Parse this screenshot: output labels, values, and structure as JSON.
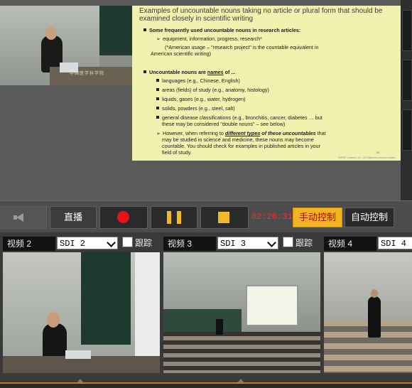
{
  "slide": {
    "title": "Examples of uncountable nouns taking no article or plural form that should be examined closely in scientific writing",
    "heading1": "Some frequently used uncountable nouns in research articles:",
    "line1": "equipment, information, progress, research*",
    "line2a": "(*American usage – \"research project\" is the countable equivalent in",
    "line2b": "American scientific writing)",
    "heading2_pre": "Uncountable nouns are ",
    "heading2_em": "names",
    "heading2_post": " of ...",
    "items": [
      "languages (e.g., Chinese, English)",
      "areas (fields) of study (e.g., anatomy, histology)",
      "liquids, gases (e.g., water, hydrogen)",
      "solids, powders (e.g., steel, salt)",
      "general disease classifications (e.g., bronchitis, cancer, diabetes … but"
    ],
    "items_cont": "these may be considered \"double nouns\" – see below)",
    "however_pre": "However, when referring to ",
    "however_em": "different types",
    "however_mid": " of these uncountables",
    "however_post": " that",
    "however2": "may be studied in science and medicine, these nouns may become",
    "however3": "countable.  You should check for examples in published articles in your",
    "however4": "field of study.",
    "page_no": "68",
    "footer": "SWSF Lecture 13 - 21 Zabner's lecture notes"
  },
  "preview": {
    "desk_text": "中国医学科学院"
  },
  "controls": {
    "live_label": "直播",
    "timer": "02:20:31",
    "manual_label": "手动控制",
    "auto_label": "自动控制",
    "colors": {
      "record": "#e8121b",
      "pause": "#f3b82a",
      "manual_bg": "#f2b51f",
      "timer": "#ff2a2a"
    }
  },
  "panels": [
    {
      "label": "视频 2",
      "source": "SDI 2",
      "track": "跟踪"
    },
    {
      "label": "视频 3",
      "source": "SDI 3",
      "track": "跟踪"
    },
    {
      "label": "视频 4",
      "source": "SDI 4",
      "track": ""
    }
  ]
}
